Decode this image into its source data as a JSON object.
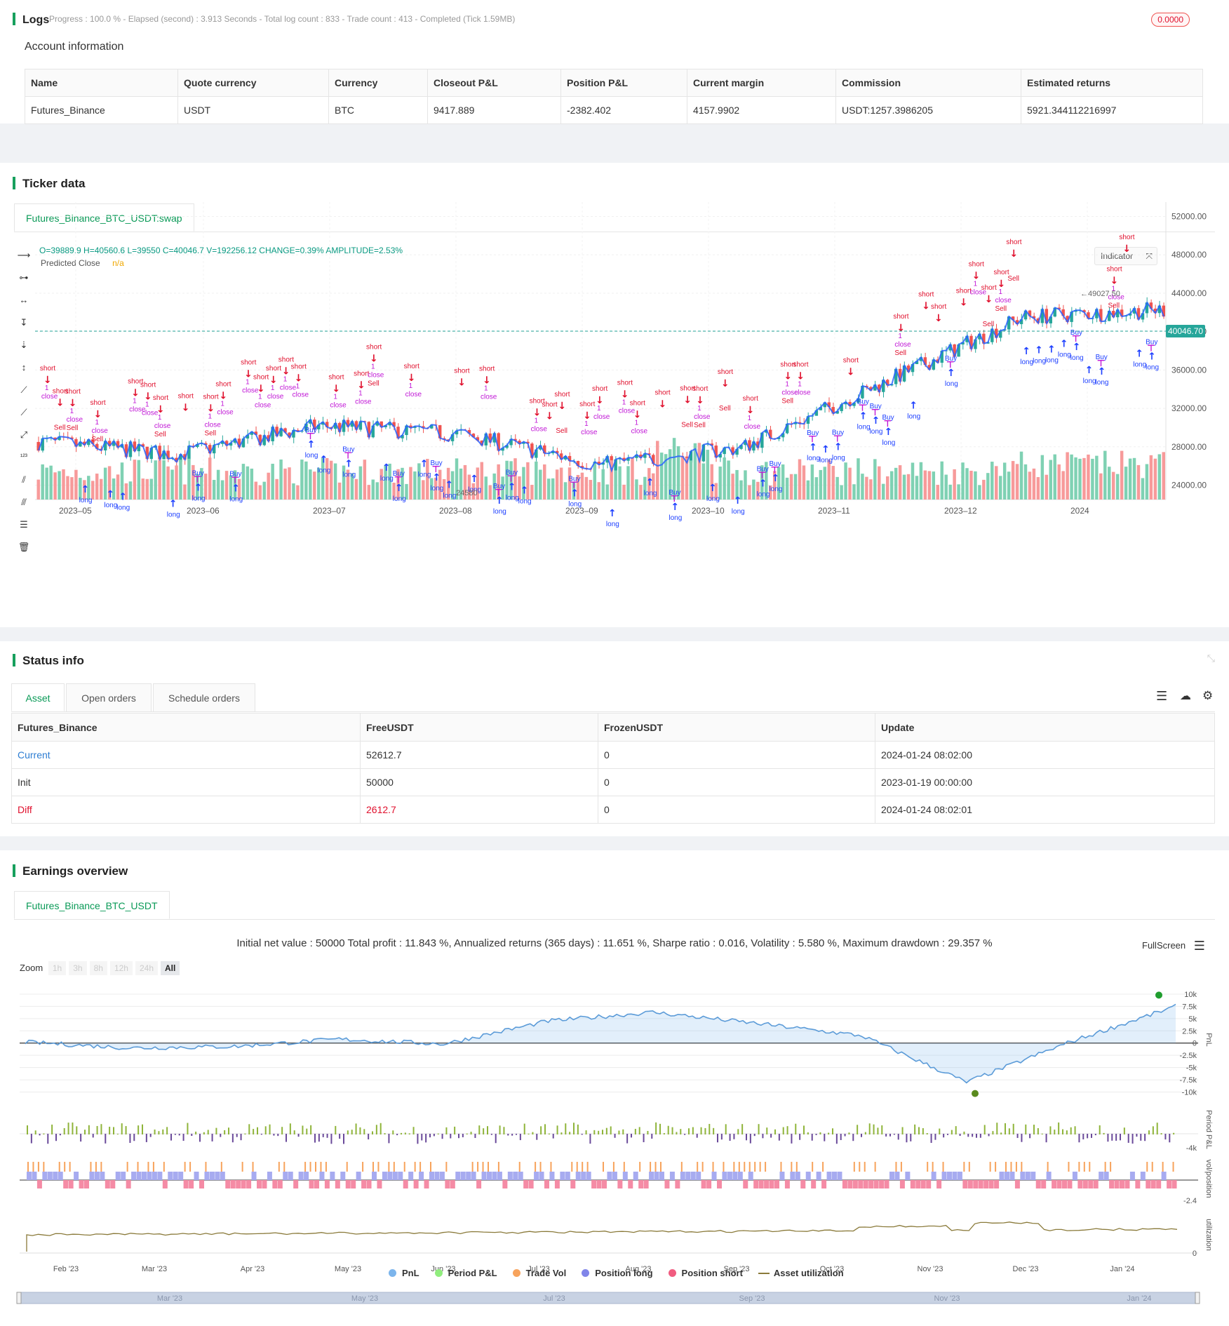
{
  "logs": {
    "title": "Logs",
    "status_line": "Progress : 100.0 % - Elapsed (second) : 3.913  Seconds - Total log count : 833 - Trade count : 413 - Completed (Tick 1.59MB)",
    "badge": "0.0000"
  },
  "account": {
    "title": "Account information",
    "headers": [
      "Name",
      "Quote currency",
      "Currency",
      "Closeout P&L",
      "Position P&L",
      "Current margin",
      "Commission",
      "Estimated returns"
    ],
    "row": [
      "Futures_Binance",
      "USDT",
      "BTC",
      "9417.889",
      "-2382.402",
      "4157.9902",
      "USDT:1257.3986205",
      "5921.344112216997"
    ]
  },
  "ticker": {
    "title": "Ticker data",
    "tab": "Futures_Binance_BTC_USDT:swap",
    "ohlc": "O=39889.9 H=40560.6 L=39550 C=40046.7 V=192256.12 CHANGE=0.39% AMPLITUDE=2.53%",
    "predicted_label": "Predicted Close",
    "predicted_value": "n/a",
    "indicator_btn": "Indicator",
    "current_price": "40046.70",
    "annotation_high": "49027.50",
    "annotation_low": "24580",
    "y_ticks": [
      "52000.00",
      "48000.00",
      "44000.00",
      "40000.00",
      "36000.00",
      "32000.00",
      "28000.00",
      "24000.00"
    ],
    "x_ticks": [
      "2023–05",
      "2023–06",
      "2023–07",
      "2023–08",
      "2023–09",
      "2023–10",
      "2023–11",
      "2023–12",
      "2024"
    ],
    "signal_labels": {
      "short": "short",
      "long": "long",
      "close": "close",
      "buy": "Buy",
      "sell": "Sell",
      "one": "1"
    },
    "colors": {
      "up": "#26a69a",
      "down": "#ef5350",
      "line": "#2962ff",
      "short": "#e0102d",
      "long": "#1e40ff",
      "close": "#c015d6"
    }
  },
  "status": {
    "title": "Status info",
    "tabs": [
      "Asset",
      "Open orders",
      "Schedule orders"
    ],
    "headers": [
      "Futures_Binance",
      "FreeUSDT",
      "FrozenUSDT",
      "Update"
    ],
    "rows": [
      [
        "Current",
        "52612.7",
        "0",
        "2024-01-24 08:02:00"
      ],
      [
        "Init",
        "50000",
        "0",
        "2023-01-19 00:00:00"
      ],
      [
        "Diff",
        "2612.7",
        "0",
        "2024-01-24 08:02:01"
      ]
    ]
  },
  "earnings": {
    "title": "Earnings overview",
    "tab": "Futures_Binance_BTC_USDT",
    "summary": "Initial net value : 50000  Total profit : 11.843 %, Annualized returns (365 days) : 11.651 %, Sharpe ratio : 0.016, Volatility : 5.580 %, Maximum drawdown : 29.357 %",
    "fullscreen": "FullScreen",
    "zoom_label": "Zoom",
    "zoom_options": [
      "1h",
      "3h",
      "8h",
      "12h",
      "24h",
      "All"
    ],
    "zoom_selected": "All",
    "pnl_ticks": [
      "10k",
      "7.5k",
      "5k",
      "2.5k",
      "0",
      "-2.5k",
      "-5k",
      "-7.5k",
      "-10k"
    ],
    "axis_titles": [
      "PnL",
      "Period P&L",
      "vol/position",
      "utilization"
    ],
    "ppl_tick": "-4k",
    "vol_tick": "-2.4",
    "util_tick": "0",
    "x_ticks": [
      "Feb '23",
      "Mar '23",
      "Apr '23",
      "May '23",
      "Jun '23",
      "Jul '23",
      "Aug '23",
      "Sep '23",
      "Oct '23",
      "Nov '23",
      "Dec '23",
      "Jan '24"
    ],
    "nav_ticks": [
      "Mar '23",
      "May '23",
      "Jul '23",
      "Sep '23",
      "Nov '23",
      "Jan '24"
    ],
    "legend": [
      {
        "label": "PnL",
        "color": "#7cb5ec"
      },
      {
        "label": "Period P&L",
        "color": "#90ed7d"
      },
      {
        "label": "Trade Vol",
        "color": "#f7a35c"
      },
      {
        "label": "Position long",
        "color": "#8085e9"
      },
      {
        "label": "Position short",
        "color": "#f15c80"
      },
      {
        "label": "Asset utilization",
        "color": "#8a7a3a"
      }
    ]
  },
  "chart_data": [
    {
      "type": "candlestick",
      "title": "",
      "x": [
        "2023-05",
        "2023-06",
        "2023-07",
        "2023-08",
        "2023-09",
        "2023-10",
        "2023-11",
        "2023-12",
        "2024"
      ],
      "close": [
        28500,
        27200,
        30200,
        29300,
        26100,
        27900,
        34600,
        41500,
        42300
      ],
      "last_close": 40046.7,
      "ylim": [
        22500,
        53500
      ]
    },
    {
      "type": "line",
      "title": "",
      "x": [
        "Feb '23",
        "Mar '23",
        "Apr '23",
        "May '23",
        "Jun '23",
        "Jul '23",
        "Aug '23",
        "Sep '23",
        "Oct '23",
        "Nov '23",
        "Dec '23",
        "Jan '24"
      ],
      "series": [
        {
          "name": "PnL",
          "values": [
            200,
            -1000,
            -700,
            800,
            -200,
            4500,
            6300,
            4000,
            1500,
            -8000,
            300,
            7500
          ]
        }
      ],
      "ylim": [
        -10500,
        11000
      ]
    }
  ]
}
